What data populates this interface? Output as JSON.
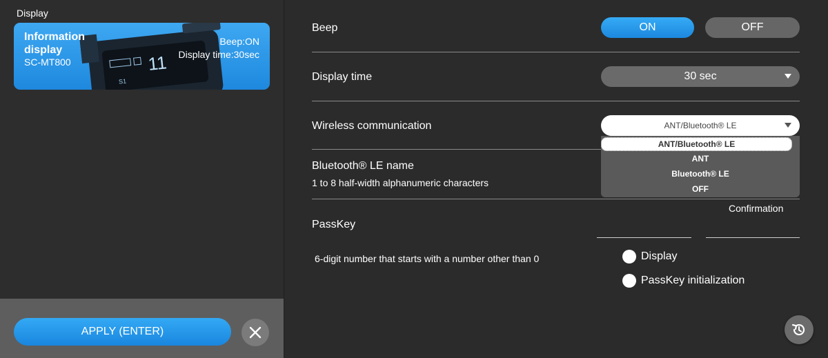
{
  "left": {
    "section_label": "Display",
    "card": {
      "title": "Information display",
      "model": "SC-MT800",
      "beep": "Beep:ON",
      "display_time": "Display time:30sec"
    },
    "apply_label": "APPLY (ENTER)",
    "close_icon": "close-icon"
  },
  "settings": {
    "beep": {
      "label": "Beep",
      "on_label": "ON",
      "off_label": "OFF",
      "selected": "ON"
    },
    "display_time": {
      "label": "Display time",
      "value": "30 sec"
    },
    "wireless": {
      "label": "Wireless communication",
      "value": "ANT/Bluetooth® LE",
      "options": [
        "ANT/Bluetooth® LE",
        "ANT",
        "Bluetooth® LE",
        "OFF"
      ]
    },
    "bt_name": {
      "label": "Bluetooth® LE name",
      "hint": "1 to 8 half-width alphanumeric characters"
    },
    "passkey": {
      "label": "PassKey",
      "confirmation_label": "Confirmation",
      "hint": "6-digit number that starts with a number other than 0",
      "radio_display": "Display",
      "radio_init": "PassKey initialization"
    }
  },
  "colors": {
    "accent": "#1e8ae0",
    "panel": "#2b2b2b",
    "footer": "#5e5e5e"
  },
  "icons": {
    "history": "history-icon",
    "caret": "chevron-down-icon"
  }
}
